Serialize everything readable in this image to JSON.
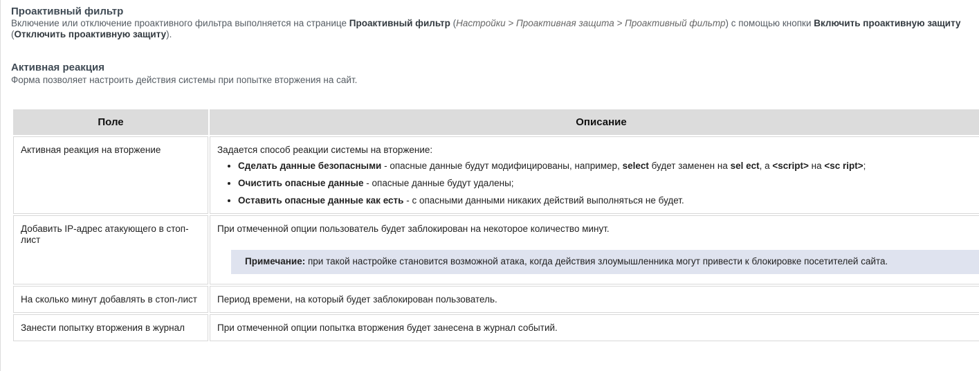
{
  "proactive": {
    "title": "Проактивный фильтр",
    "text_1": "Включение или отключение проактивного фильтра выполняется на странице ",
    "page_name": "Проактивный фильтр",
    "paren_open": " (",
    "path": "Настройки > Проактивная защита > Проактивный фильтр",
    "text_2": ") с помощью кнопки ",
    "enable_btn": "Включить проактивную защиту",
    "text_3": " (",
    "disable_btn": "Отключить проактивную защиту",
    "text_4": ")."
  },
  "active": {
    "title": "Активная реакция",
    "description": "Форма позволяет настроить действия системы при попытке вторжения на сайт."
  },
  "table": {
    "headers": [
      "Поле",
      "Описание"
    ],
    "rows": [
      {
        "field": "Активная реакция на вторжение",
        "intro": "Задается способ реакции системы на вторжение:",
        "options": [
          {
            "label": "Сделать данные безопасными",
            "t1": " - опасные данные будут модифицированы, например, ",
            "code1": "select",
            "t2": " будет заменен на ",
            "code2": "sel ect",
            "t3": ", а ",
            "code3": "<script>",
            "t4": " на ",
            "code4": "<sc ript>",
            "t5": ";"
          },
          {
            "label": "Очистить опасные данные",
            "text": " - опасные данные будут удалены;"
          },
          {
            "label": "Оставить опасные данные как есть",
            "text": " - с опасными данными никаких действий выполняться не будет."
          }
        ]
      },
      {
        "field": "Добавить IP-адрес атакующего в стоп-лист",
        "description": "При отмеченной опции пользователь будет заблокирован на некоторое количество минут.",
        "note_label": "Примечание:",
        "note_text": " при такой настройке становится возможной атака, когда действия злоумышленника могут привести к блокировке посетителей сайта."
      },
      {
        "field": "На сколько минут добавлять в стоп-лист",
        "description": "Период времени, на который будет заблокирован пользователь."
      },
      {
        "field": "Занести попытку вторжения в журнал",
        "description": "При отмеченной опции попытка вторжения будет занесена в журнал событий."
      }
    ]
  }
}
